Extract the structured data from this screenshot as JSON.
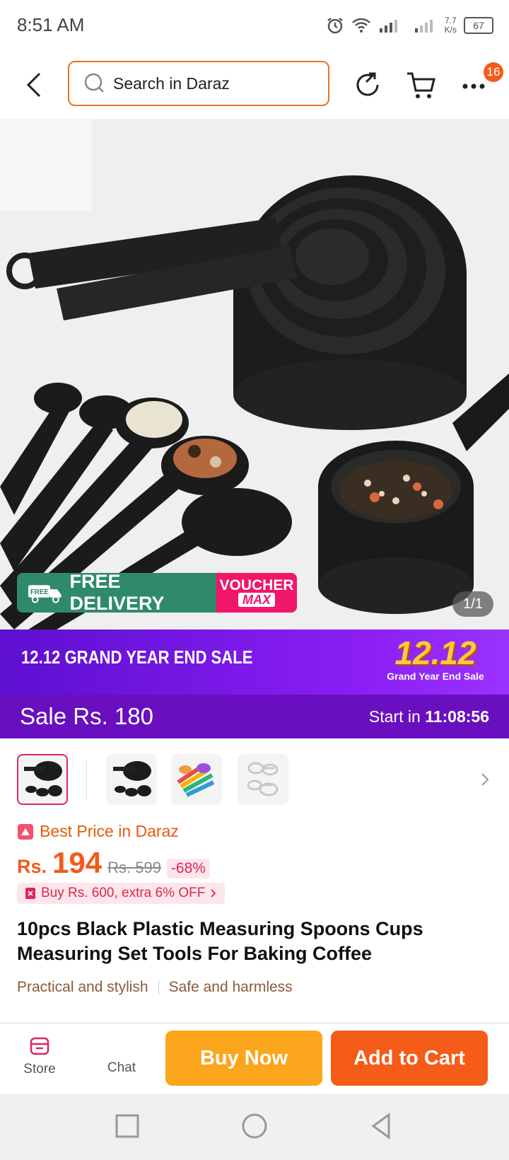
{
  "status_bar": {
    "time": "8:51 AM",
    "net_speed_value": "7.7",
    "net_speed_unit": "K/s",
    "battery": "67"
  },
  "header": {
    "search_placeholder": "Search in Daraz",
    "cart_badge": "16"
  },
  "hero": {
    "pager": "1/1",
    "free_delivery": "FREE DELIVERY",
    "free_tag": "FREE",
    "voucher": "VOUCHER",
    "voucher_max": "MAX"
  },
  "sale_banner": {
    "title": "12.12 GRAND YEAR END SALE",
    "logo_big": "12.12",
    "logo_small": "Grand Year End Sale",
    "sale_label": "Sale",
    "sale_price": "Rs. 180",
    "start_label": "Start in",
    "countdown": "11:08:56"
  },
  "price": {
    "best_price": "Best Price in Daraz",
    "currency": "Rs.",
    "value": "194",
    "original": "Rs. 599",
    "discount": "-68%",
    "promo": "Buy Rs. 600, extra 6% OFF"
  },
  "product": {
    "title": "10pcs Black Plastic Measuring Spoons Cups Measuring Set Tools For Baking Coffee",
    "tags": [
      "Practical and stylish",
      "Safe and harmless"
    ]
  },
  "bottom_bar": {
    "store": "Store",
    "chat": "Chat",
    "buy_now": "Buy Now",
    "add_to_cart": "Add to Cart"
  },
  "colors": {
    "accent": "#f35a1b",
    "buy": "#fba61d",
    "sale_purple": "#6a0fbf",
    "free_green": "#2f8a6b",
    "voucher_pink": "#f0166a"
  }
}
